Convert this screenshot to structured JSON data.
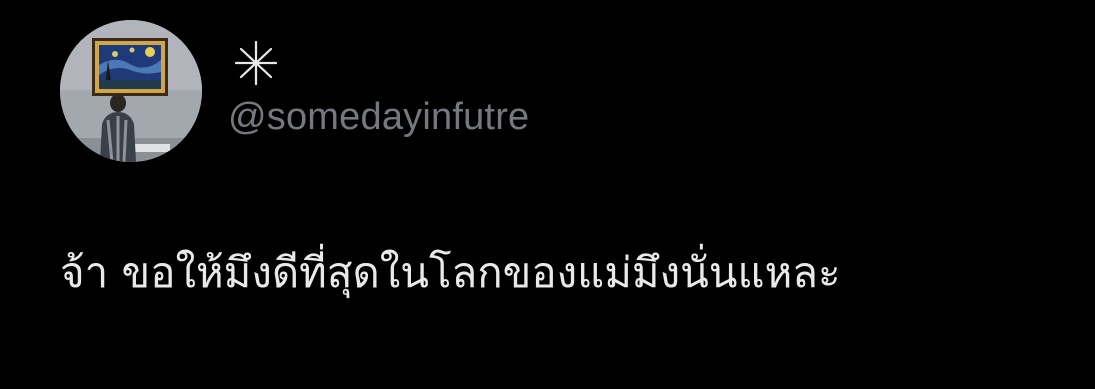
{
  "author": {
    "display_name": "✳",
    "display_name_icon": "asterisk-icon",
    "handle": "@somedayinfutre",
    "avatar_icon": "starry-night-viewer-avatar"
  },
  "tweet": {
    "text": "จ้า ขอให้มึงดีที่สุดในโลกของแม่มึงนั่นแหละ"
  },
  "colors": {
    "background": "#000000",
    "text_primary": "#e7e9ea",
    "text_secondary": "#75797e"
  }
}
